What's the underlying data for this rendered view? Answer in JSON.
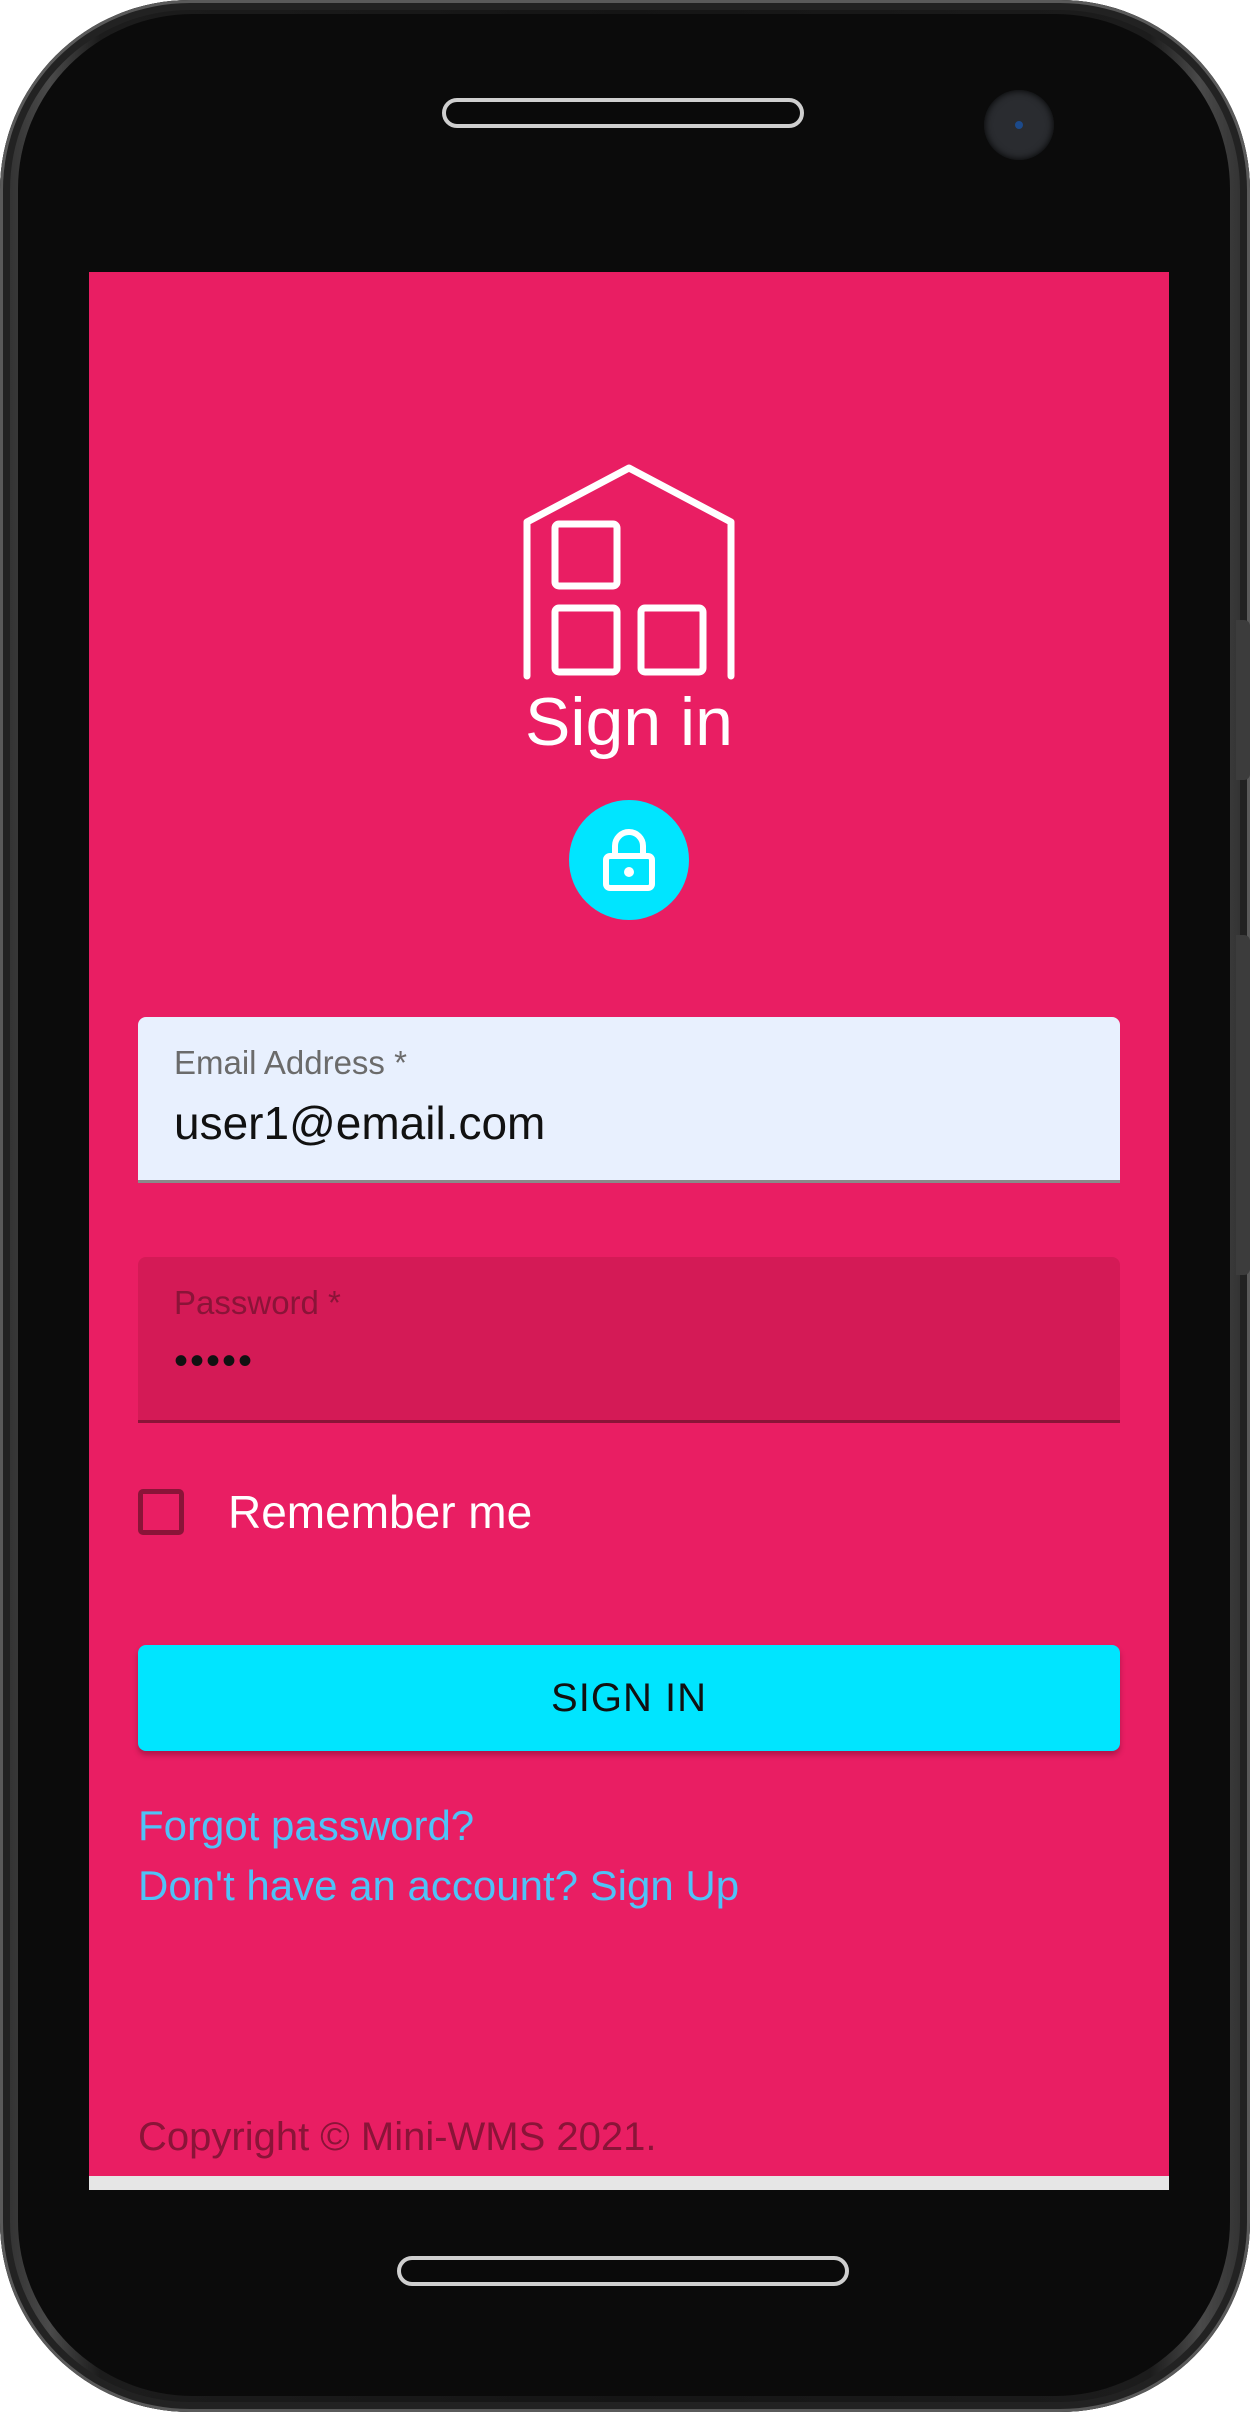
{
  "colors": {
    "screen_background": "#e91e63",
    "accent": "#00e5ff",
    "link": "#4fc3f7",
    "email_field_bg": "#e8f0fe",
    "password_field_bg": "#d41a56"
  },
  "header": {
    "logo_icon": "warehouse-icon",
    "title": "Sign in",
    "avatar_icon": "lock-icon"
  },
  "form": {
    "email": {
      "label": "Email Address *",
      "value": "user1@email.com"
    },
    "password": {
      "label": "Password *",
      "value": "•••••"
    },
    "remember": {
      "label": "Remember me",
      "checked": false
    },
    "submit_label": "SIGN IN"
  },
  "links": {
    "forgot_password": "Forgot password?",
    "sign_up": "Don't have an account? Sign Up"
  },
  "footer": {
    "copyright": "Copyright © Mini-WMS 2021."
  }
}
